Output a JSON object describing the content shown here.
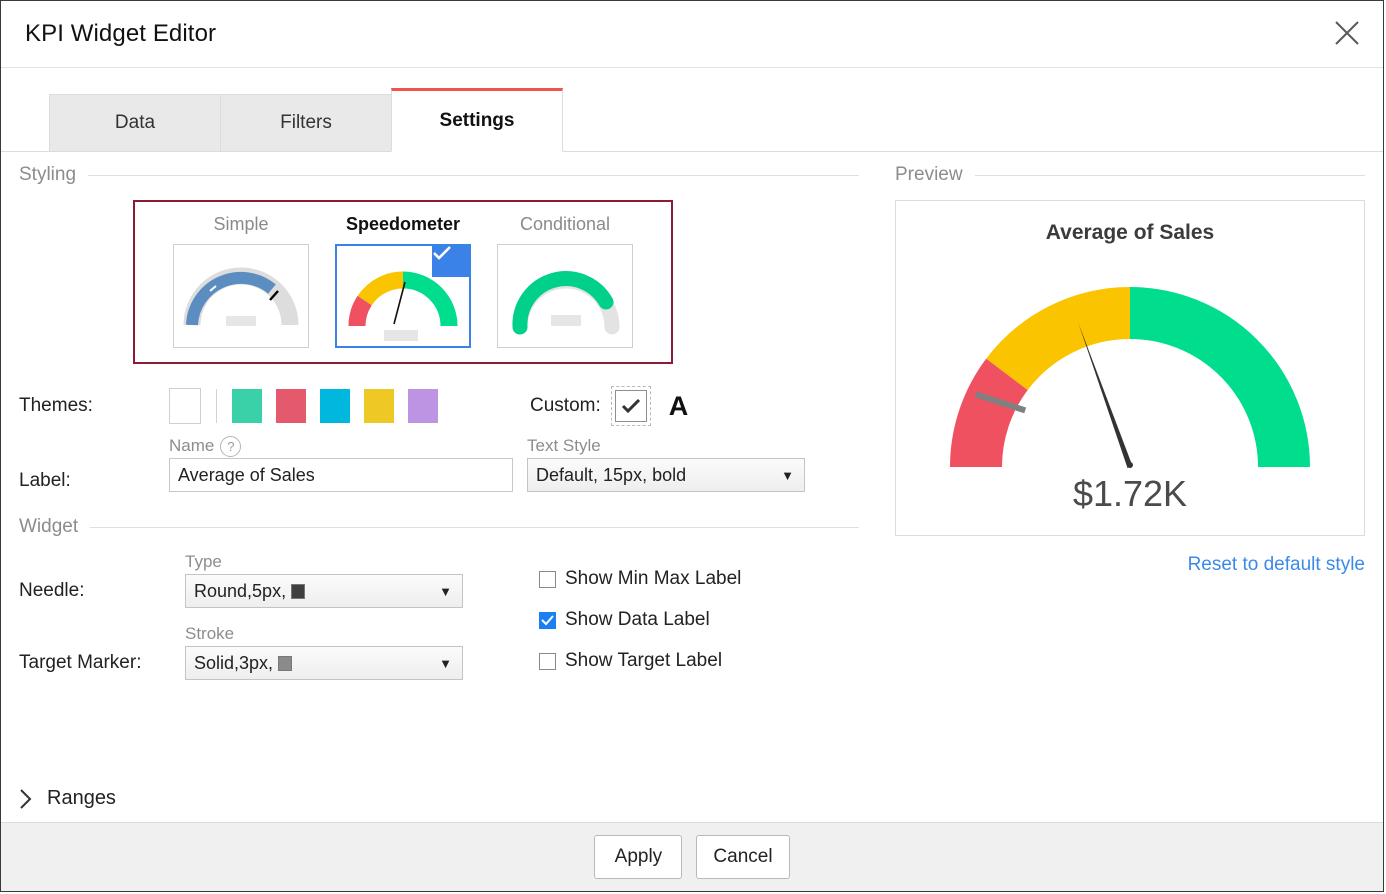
{
  "dialog": {
    "title": "KPI Widget Editor",
    "close_icon": "close-icon"
  },
  "tabs": [
    {
      "label": "Data",
      "active": false
    },
    {
      "label": "Filters",
      "active": false
    },
    {
      "label": "Settings",
      "active": true
    }
  ],
  "styling": {
    "heading": "Styling",
    "options": [
      {
        "label": "Simple",
        "selected": false
      },
      {
        "label": "Speedometer",
        "selected": true
      },
      {
        "label": "Conditional",
        "selected": false
      }
    ],
    "selected_border_color": "#8c1b33",
    "selected_thumb_color": "#3b82e8"
  },
  "themes": {
    "label": "Themes:",
    "blank_swatch": "#ffffff",
    "colors": [
      "#3ad1a8",
      "#e4596b",
      "#00b8dd",
      "#eec925",
      "#bd93e3"
    ],
    "custom_label": "Custom:",
    "custom_checked": true,
    "font_icon_label": "A"
  },
  "label_section": {
    "row_label": "Label:",
    "name_caption": "Name",
    "help_glyph": "?",
    "name_value": "Average of Sales",
    "text_style_caption": "Text Style",
    "text_style_value": "Default, 15px, bold"
  },
  "widget": {
    "heading": "Widget",
    "needle": {
      "row_label": "Needle:",
      "caption": "Type",
      "value": "Round,5px,",
      "color": "#3f3f3f"
    },
    "target_marker": {
      "row_label": "Target Marker:",
      "caption": "Stroke",
      "value": "Solid,3px,",
      "color": "#8a8a8a"
    },
    "checkboxes": [
      {
        "label": "Show Min Max Label",
        "checked": false
      },
      {
        "label": "Show Data Label",
        "checked": true
      },
      {
        "label": "Show Target Label",
        "checked": false
      }
    ]
  },
  "ranges": {
    "label": "Ranges",
    "expand_icon": "chevron-right-icon",
    "expanded": false
  },
  "preview": {
    "heading": "Preview",
    "reset_link": "Reset to default style",
    "gauge_title": "Average of Sales",
    "data_label": "$1.72K"
  },
  "footer": {
    "apply_label": "Apply",
    "cancel_label": "Cancel"
  },
  "chart_data": {
    "type": "gauge",
    "title": "Average of Sales",
    "value": 1720,
    "value_label": "$1.72K",
    "min": 0,
    "max": 4000,
    "target": 400,
    "needle_angle_deg": 107,
    "target_angle_deg": 162,
    "bands": [
      {
        "name": "low",
        "color": "#ef5160",
        "start_deg": 180,
        "end_deg": 143
      },
      {
        "name": "medium",
        "color": "#fbc400",
        "start_deg": 143,
        "end_deg": 90
      },
      {
        "name": "high",
        "color": "#00dd8d",
        "start_deg": 90,
        "end_deg": 0
      }
    ],
    "needle_color": "#333333",
    "target_marker_color": "#808080"
  }
}
